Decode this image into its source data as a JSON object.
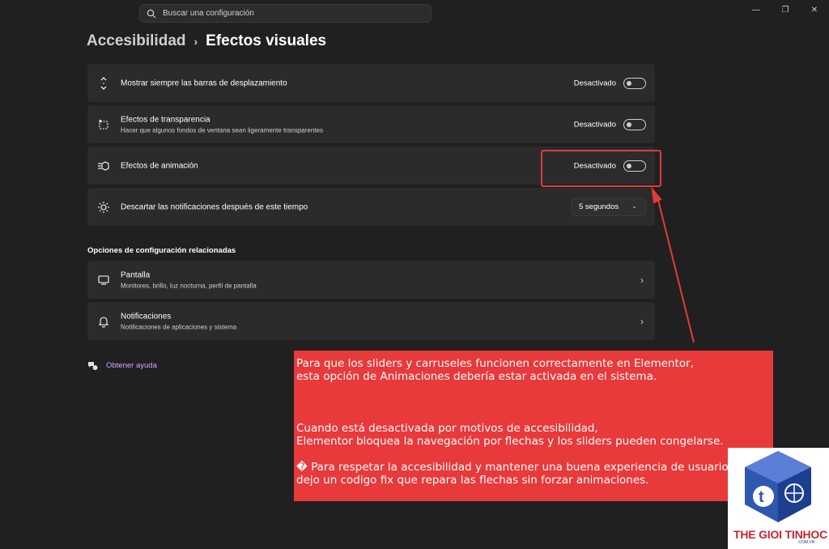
{
  "search": {
    "placeholder": "Buscar una configuración"
  },
  "window_controls": [
    "minimize-icon",
    "restore-icon",
    "close-icon"
  ],
  "breadcrumb": {
    "parent": "Accesibilidad",
    "current": "Efectos visuales"
  },
  "settings": [
    {
      "title": "Mostrar siempre las barras de desplazamiento",
      "state": "Desactivado",
      "icon": "scroll-arrows-icon"
    },
    {
      "title": "Efectos de transparencia",
      "subtitle": "Hacer que algunos fondos de ventana sean ligeramente transparentes",
      "state": "Desactivado",
      "icon": "transparency-icon"
    },
    {
      "title": "Efectos de animación",
      "state": "Desactivado",
      "icon": "animation-icon"
    },
    {
      "title": "Descartar las notificaciones después de este tiempo",
      "value": "5 segundos",
      "icon": "sun-icon"
    }
  ],
  "related": {
    "title": "Opciones de configuración relacionadas",
    "items": [
      {
        "title": "Pantalla",
        "subtitle": "Monitores, brillo, luz nocturna, perfil de pantalla",
        "icon": "monitor-icon"
      },
      {
        "title": "Notificaciones",
        "subtitle": "Notificaciones de aplicaciones y sistema",
        "icon": "bell-icon"
      }
    ]
  },
  "help": {
    "label": "Obtener ayuda"
  },
  "note": {
    "line1": "Para que los sliders y carruseles funcionen correctamente en Elementor,",
    "line2": "esta opción de Animaciones debería estar activada en el sistema.",
    "line3": "Cuando está desactivada por motivos de accesibilidad,",
    "line4": "Elementor bloquea la navegación por flechas y los sliders pueden congelarse.",
    "line5": "� Para respetar la accesibilidad y mantener una buena experiencia de usuario (UX),",
    "line6": "dejo un codigo fix que repara las flechas sin forzar animaciones."
  },
  "watermark": {
    "brand": "THE GIOI TINHOC",
    "domain": ".COM.VN"
  },
  "colors": {
    "background": "#202020",
    "card": "#2b2b2b",
    "accent_link": "#d7a4ff",
    "annotation": "#e8393b"
  }
}
